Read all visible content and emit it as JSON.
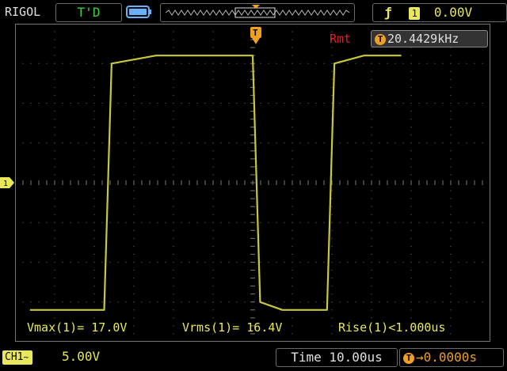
{
  "header": {
    "brand": "RIGOL",
    "run_status": "T'D",
    "trigger": {
      "edge_symbol": "ƒ",
      "channel": "1",
      "level": "0.00V"
    }
  },
  "measure": {
    "rmt_label": "Rmt",
    "frequency_badge": "T",
    "frequency": "20.4429kHz",
    "vmax": "Vmax(1)= 17.0V",
    "vrms": "Vrms(1)= 16.4V",
    "rise": "Rise(1)<1.000us"
  },
  "footer": {
    "channel_label": "CH1",
    "coupling_symbol": "~",
    "volts_per_div": "5.00V",
    "timebase": "Time 10.00us",
    "offset_badge": "T",
    "offset_arrow": "→",
    "trigger_offset": "0.0000s"
  },
  "markers": {
    "trigger_marker": "T",
    "channel_marker": "1"
  },
  "colors": {
    "trace": "#c8c83a",
    "accent_yellow": "#e8e85a",
    "status_green": "#3fd23f",
    "trigger_orange": "#f0a020",
    "rmt_red": "#e02020"
  },
  "chart_data": {
    "type": "line",
    "title": "",
    "xlabel": "",
    "ylabel": "",
    "series": [
      {
        "x": [
          0,
          10,
          11,
          17,
          18,
          30,
          31,
          34,
          35,
          40,
          41,
          45,
          46,
          50
        ],
        "values": [
          -3.2,
          -3.2,
          3.0,
          3.2,
          3.2,
          3.2,
          -3.0,
          -3.2,
          -3.2,
          -3.2,
          3.0,
          3.2,
          3.2,
          3.2
        ]
      }
    ],
    "x_unit": "us",
    "y_unit": "div",
    "xlim": [
      -2,
      62
    ],
    "ylim": [
      -4,
      4
    ],
    "grid": true
  }
}
